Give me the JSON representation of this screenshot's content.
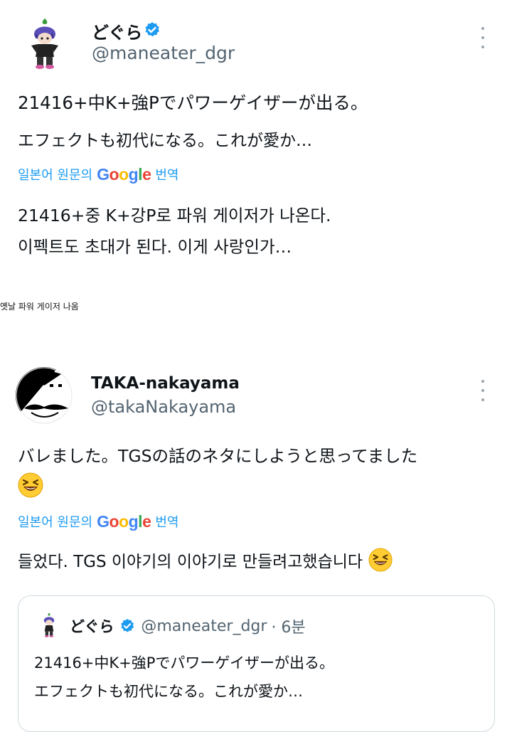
{
  "tweet1": {
    "display_name": "どぐら",
    "handle": "@maneater_dgr",
    "text_line1": "21416+中K+強Pでパワーゲイザーが出る。",
    "text_line2": "エフェクトも初代になる。これが愛か…",
    "translate_prefix": "일본어 원문의",
    "translate_brand": "Google",
    "translate_suffix": "번역",
    "translated_line1": "21416+중 K+강P로 파워 게이저가 나온다.",
    "translated_line2": "이펙트도 초대가 된다. 이게 사랑인가…"
  },
  "caption": "옛날 파워 게이저 나옴",
  "tweet2": {
    "display_name": "TAKA-nakayama",
    "handle": "@takaNakayama",
    "text_line1": "バレました。TGSの話のネタにしようと思ってました",
    "translate_prefix": "일본어 원문의",
    "translate_brand": "Google",
    "translate_suffix": "번역",
    "translated_line1": "들었다. TGS 이야기의 이야기로 만들려고했습니다",
    "quote": {
      "display_name": "どぐら",
      "handle": "@maneater_dgr",
      "time": "· 6분",
      "text_line1": "21416+中K+強Pでパワーゲイザーが出る。",
      "text_line2": "エフェクトも初代になる。これが愛か…"
    }
  },
  "colors": {
    "verified": "#1d9bf0",
    "link": "#1d9bf0",
    "secondary_text": "#536471",
    "google_blue": "#4285F4",
    "google_red": "#EA4335",
    "google_yellow": "#FBBC05",
    "google_green": "#34A853"
  },
  "icons": {
    "verified": "verified-badge-icon",
    "more": "more-options-icon",
    "emoji": "grinning-squinting-face-emoji"
  }
}
